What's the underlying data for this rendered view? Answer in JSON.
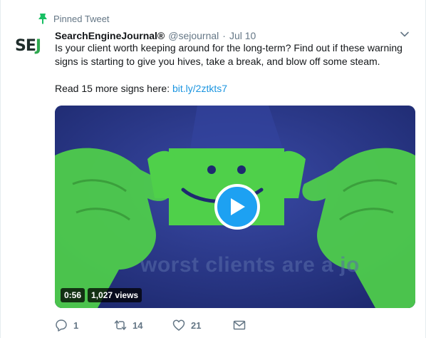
{
  "pinned_label": "Pinned Tweet",
  "author": {
    "name": "SearchEngineJournal®",
    "handle": "@sejournal",
    "separator": "·",
    "date": "Jul 10",
    "avatar_text_main": "SE",
    "avatar_text_accent": "J"
  },
  "tweet": {
    "line1": "Is your client worth keeping around for the long-term? Find out if these warning signs is starting to give you hives, take a break, and blow off some steam.",
    "line2_prefix": "Read 15 more signs here: ",
    "link_text": "bit.ly/2ztkts7"
  },
  "media": {
    "overlay_text": "worst clients are a jo",
    "duration": "0:56",
    "views": "1,027 views",
    "colors": {
      "background": "#2b3a8e",
      "green": "#4fd04a",
      "play": "#1da1f2"
    }
  },
  "actions": {
    "reply_count": "1",
    "retweet_count": "14",
    "like_count": "21"
  },
  "icons": {
    "pin": "pin-icon",
    "caret": "chevron-down-icon",
    "play": "play-icon",
    "reply": "reply-icon",
    "retweet": "retweet-icon",
    "like": "heart-icon",
    "dm": "envelope-icon"
  },
  "colors": {
    "accent": "#1da1f2",
    "link": "#1b95e0",
    "muted": "#657786",
    "pin": "#17bf63"
  }
}
